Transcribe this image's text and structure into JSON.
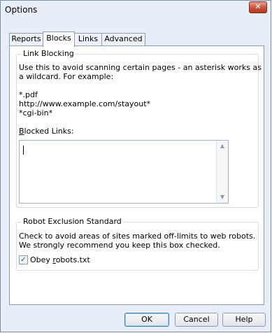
{
  "window": {
    "title": "Options",
    "close_glyph": "✕"
  },
  "tabs": [
    {
      "label": "Reports",
      "active": false
    },
    {
      "label": "Blocks",
      "active": true
    },
    {
      "label": "Links",
      "active": false
    },
    {
      "label": "Advanced",
      "active": false
    }
  ],
  "link_blocking": {
    "legend": "Link Blocking",
    "description_line1": "Use this to avoid scanning certain pages - an asterisk works as",
    "description_line2": "a wildcard. For example:",
    "examples": [
      "*.pdf",
      "http://www.example.com/stayout*",
      "*cgi-bin*"
    ],
    "blocked_label_mnemonic": "B",
    "blocked_label_rest": "locked Links:",
    "blocked_value": ""
  },
  "robots": {
    "legend": "Robot Exclusion Standard",
    "description_line1": "Check to avoid areas of sites marked off-limits to web robots.",
    "description_line2": "We strongly recommend you keep this box checked.",
    "checkbox_prefix": "Obey ",
    "checkbox_mnemonic": "r",
    "checkbox_rest": "obots.txt",
    "checked": true,
    "check_glyph": "✓"
  },
  "buttons": {
    "ok": "OK",
    "cancel": "Cancel",
    "help": "Help"
  },
  "icons": {
    "scroll_up": "▲",
    "scroll_down": "▼"
  }
}
